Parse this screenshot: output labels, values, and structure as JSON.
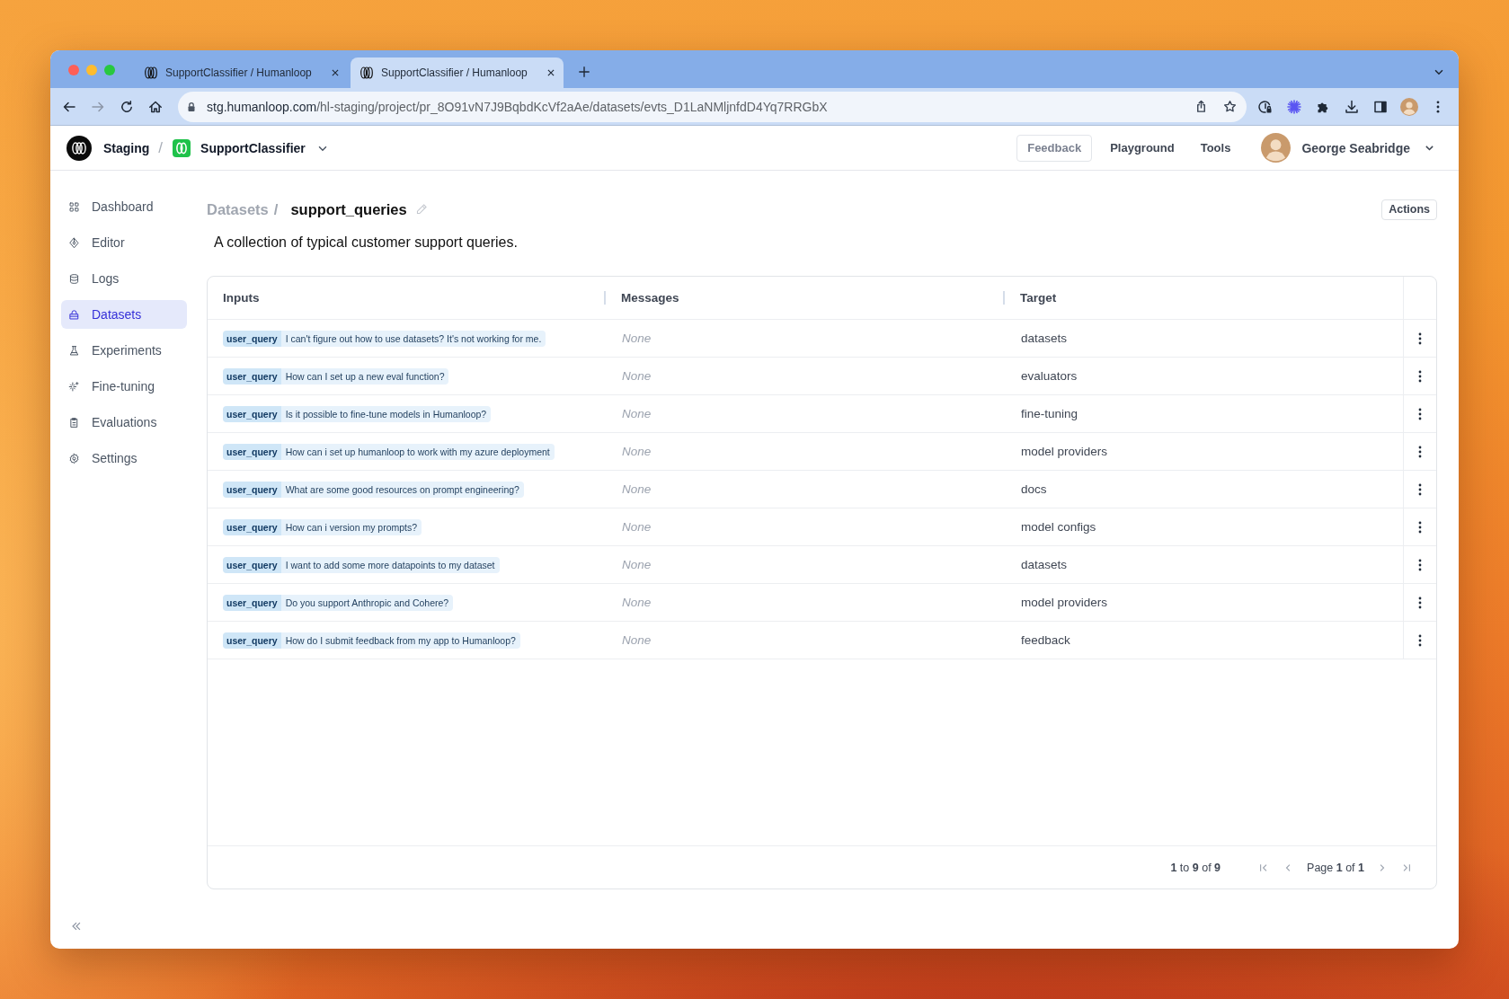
{
  "browser": {
    "tabs": [
      {
        "title": "SupportClassifier / Humanloop",
        "selected": false
      },
      {
        "title": "SupportClassifier / Humanloop",
        "selected": true
      }
    ],
    "address_bar": {
      "url": "stg.humanloop.com/hl-staging/project/pr_8O91vN7J9BqbdKcVf2aAe/datasets/evts_D1LaNMljnfdD4Yq7RRGbX"
    }
  },
  "header": {
    "workspace": "Staging",
    "separator": "/",
    "project": "SupportClassifier",
    "nav": [
      {
        "label": "Feedback",
        "kind": "outlined"
      },
      {
        "label": "Playground",
        "kind": "plain"
      },
      {
        "label": "Tools",
        "kind": "plain"
      }
    ],
    "user": {
      "name": "George Seabridge"
    }
  },
  "sidebar": {
    "items": [
      {
        "label": "Dashboard",
        "selected": false
      },
      {
        "label": "Editor",
        "selected": false
      },
      {
        "label": "Logs",
        "selected": false
      },
      {
        "label": "Datasets",
        "selected": true
      },
      {
        "label": "Experiments",
        "selected": false
      },
      {
        "label": "Fine-tuning",
        "selected": false
      },
      {
        "label": "Evaluations",
        "selected": false
      },
      {
        "label": "Settings",
        "selected": false
      }
    ]
  },
  "breadcrumb": {
    "parent": "Datasets",
    "separator": "/",
    "current": "support_queries"
  },
  "actions_button": "Actions",
  "description": "A collection of typical customer support queries.",
  "table": {
    "columns": [
      "Inputs",
      "Messages",
      "Target"
    ],
    "rows": [
      {
        "inputs": [
          {
            "key": "user_query",
            "value": "I can't figure out how to use datasets? It's not working for me."
          }
        ],
        "messages": "None",
        "target": "datasets"
      },
      {
        "inputs": [
          {
            "key": "user_query",
            "value": "How can I set up a new eval function?"
          }
        ],
        "messages": "None",
        "target": "evaluators"
      },
      {
        "inputs": [
          {
            "key": "user_query",
            "value": "Is it possible to fine-tune models in Humanloop?"
          }
        ],
        "messages": "None",
        "target": "fine-tuning"
      },
      {
        "inputs": [
          {
            "key": "user_query",
            "value": "How can i set up humanloop to work with my azure deployment"
          }
        ],
        "messages": "None",
        "target": "model providers"
      },
      {
        "inputs": [
          {
            "key": "user_query",
            "value": "What are some good resources on prompt engineering?"
          }
        ],
        "messages": "None",
        "target": "docs"
      },
      {
        "inputs": [
          {
            "key": "user_query",
            "value": "How can i version my prompts?"
          }
        ],
        "messages": "None",
        "target": "model configs"
      },
      {
        "inputs": [
          {
            "key": "user_query",
            "value": "I want to add some more datapoints to my dataset"
          }
        ],
        "messages": "None",
        "target": "datasets"
      },
      {
        "inputs": [
          {
            "key": "user_query",
            "value": "Do you support Anthropic and Cohere?"
          }
        ],
        "messages": "None",
        "target": "model providers"
      },
      {
        "inputs": [
          {
            "key": "user_query",
            "value": "How do I submit feedback from my app to Humanloop?"
          }
        ],
        "messages": "None",
        "target": "feedback"
      }
    ]
  },
  "pagination": {
    "summary": "**1** to **9** of **9**",
    "page": "Page **1** of **1**"
  }
}
